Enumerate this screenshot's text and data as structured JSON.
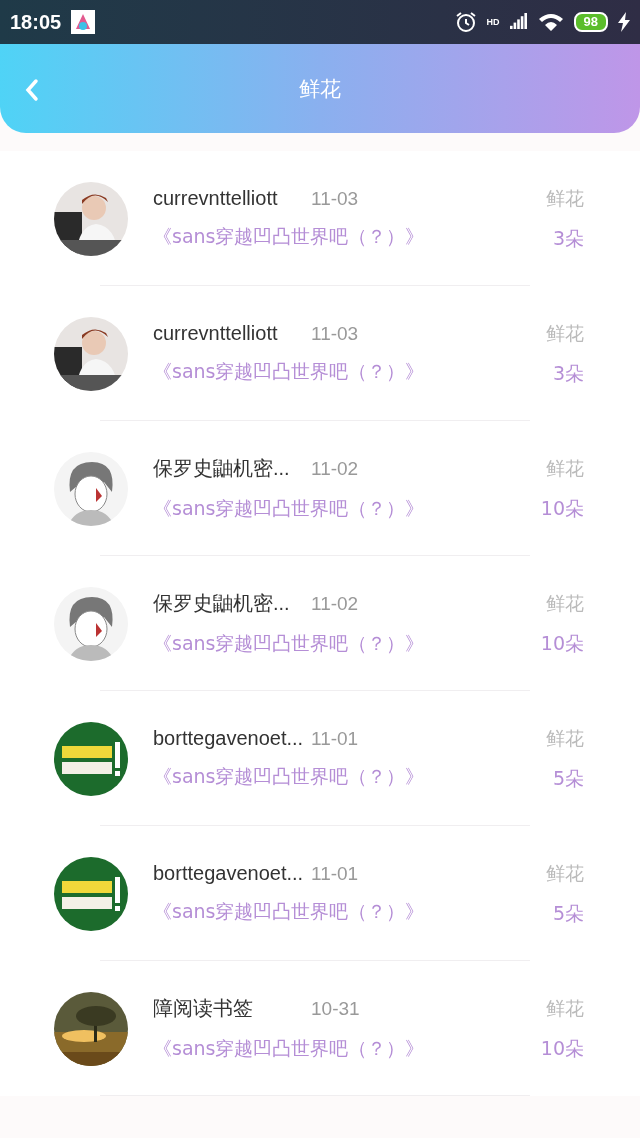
{
  "status_bar": {
    "time": "18:05",
    "network_label": "HD",
    "battery": "98"
  },
  "header": {
    "title": "鲜花"
  },
  "items": [
    {
      "name": "currevnttelliott",
      "date": "11-03",
      "book": "《sans穿越凹凸世界吧（？）》",
      "gift": "鲜花",
      "count": "3朵"
    },
    {
      "name": "currevnttelliott",
      "date": "11-03",
      "book": "《sans穿越凹凸世界吧（？）》",
      "gift": "鲜花",
      "count": "3朵"
    },
    {
      "name": "保罗史鼬机密...",
      "date": "11-02",
      "book": "《sans穿越凹凸世界吧（？）》",
      "gift": "鲜花",
      "count": "10朵"
    },
    {
      "name": "保罗史鼬机密...",
      "date": "11-02",
      "book": "《sans穿越凹凸世界吧（？）》",
      "gift": "鲜花",
      "count": "10朵"
    },
    {
      "name": "borttegavenoet...",
      "date": "11-01",
      "book": "《sans穿越凹凸世界吧（？）》",
      "gift": "鲜花",
      "count": "5朵"
    },
    {
      "name": "borttegavenoet...",
      "date": "11-01",
      "book": "《sans穿越凹凸世界吧（？）》",
      "gift": "鲜花",
      "count": "5朵"
    },
    {
      "name": "障阅读书签",
      "date": "10-31",
      "book": "《sans穿越凹凸世界吧（？）》",
      "gift": "鲜花",
      "count": "10朵"
    }
  ]
}
